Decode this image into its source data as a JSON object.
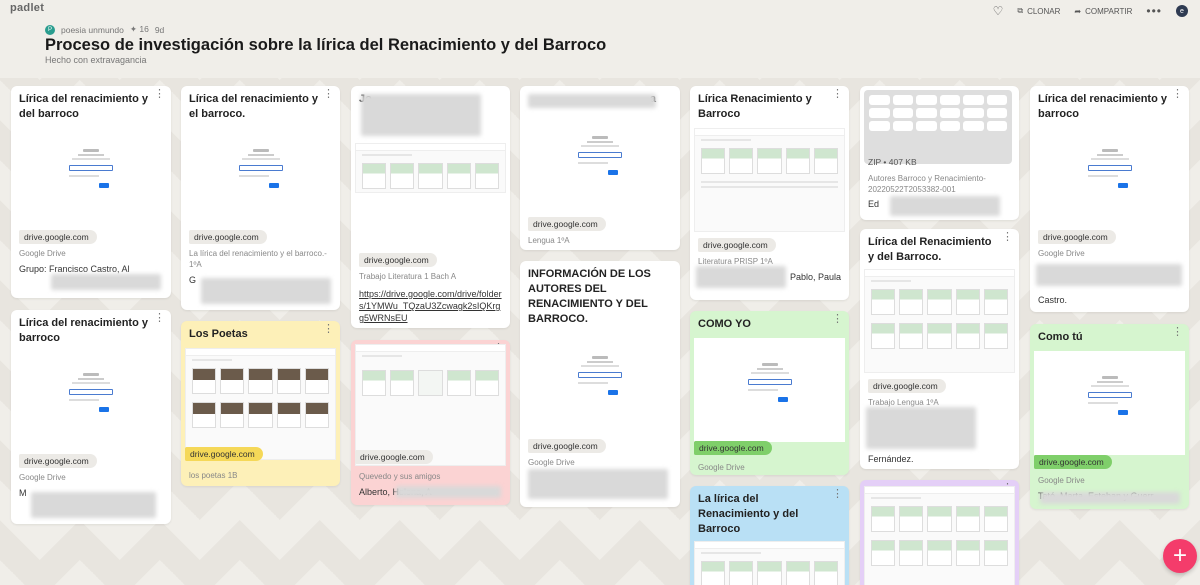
{
  "app": {
    "logo": "padlet"
  },
  "header": {
    "avatar_letter": "P",
    "author": "poesia unmundo",
    "likes": "✦ 16",
    "age": "9d",
    "title": "Proceso de investigación sobre la lírica del Renacimiento y del Barroco",
    "subtitle": "Hecho con extravagancia",
    "actions": {
      "clone": "CLONAR",
      "share": "COMPARTIR",
      "user_initial": "e"
    }
  },
  "colors": {
    "yellow": "#fdf0b8",
    "pink": "#fbd3d3",
    "green": "#d6f5cf",
    "blue": "#b9e0f5",
    "purple": "#e4cff7",
    "fab": "#f43c6b"
  },
  "icons": {
    "heart": "heart-icon",
    "clone": "clone-icon",
    "share": "share-icon",
    "more": "more-icon",
    "add": "plus-icon"
  },
  "cards": {
    "c1": {
      "title": "Lírica del renacimiento y del barroco",
      "link": "drive.google.com",
      "cap": "Google Drive",
      "body": "Grupo: Francisco Castro, Al"
    },
    "c2": {
      "title": "Lírica del renacimiento y barroco",
      "link": "drive.google.com",
      "cap": "Google Drive",
      "body": "M"
    },
    "c3": {
      "title": "Lírica del renacimiento y el barroco.",
      "link": "drive.google.com",
      "cap": "La lírica del renacimiento y el barroco.- 1ºA",
      "body": "G"
    },
    "c4": {
      "title": "Los Poetas",
      "link": "drive.google.com",
      "cap": "los poetas 1B"
    },
    "c5": {
      "title": "Jo",
      "link": "drive.google.com",
      "cap": "Trabajo Literatura 1 Bach A",
      "body": "https://drive.google.com/drive/folders/1YMWu_TQzaU3Zcwagk2sIQKrgg5WRNsEU"
    },
    "c6": {
      "link": "drive.google.com",
      "cap": "Quevedo y sus amigos",
      "body": "Alberto, Helena, A"
    },
    "c7": {
      "title": "a",
      "link": "drive.google.com",
      "cap": "Lengua 1ºA"
    },
    "c8": {
      "title": "INFORMACIÓN DE LOS AUTORES DEL RENACIMIENTO Y DEL BARROCO.",
      "link": "drive.google.com",
      "cap": "Google Drive"
    },
    "c9": {
      "title": "Lírica Renacimiento y Barroco",
      "link": "drive.google.com",
      "cap": "Literatura PRISP 1ºA",
      "body": "Pablo, Paula"
    },
    "c10": {
      "title": "COMO YO",
      "link": "drive.google.com",
      "cap": "Google Drive"
    },
    "c11": {
      "title": "La lírica del Renacimiento y del Barroco"
    },
    "c12": {
      "zip": "ZIP • 407 KB",
      "cap": "Autores Barroco y Renacimiento-20220522T2053382-001",
      "body": "Ed"
    },
    "c13": {
      "title": "Lírica del Renacimiento y del Barroco.",
      "link": "drive.google.com",
      "cap": "Trabajo Lengua 1ºA",
      "body": "Fernández."
    },
    "c14": {
      "title": "Lírica del renacimiento y barroco",
      "link": "drive.google.com",
      "cap": "Google Drive",
      "body": "Castro."
    },
    "c15": {
      "title": "Como tú",
      "link": "drive.google.com",
      "cap": "Google Drive",
      "body": "Tató, Marta, Esteban y Guerr"
    }
  }
}
